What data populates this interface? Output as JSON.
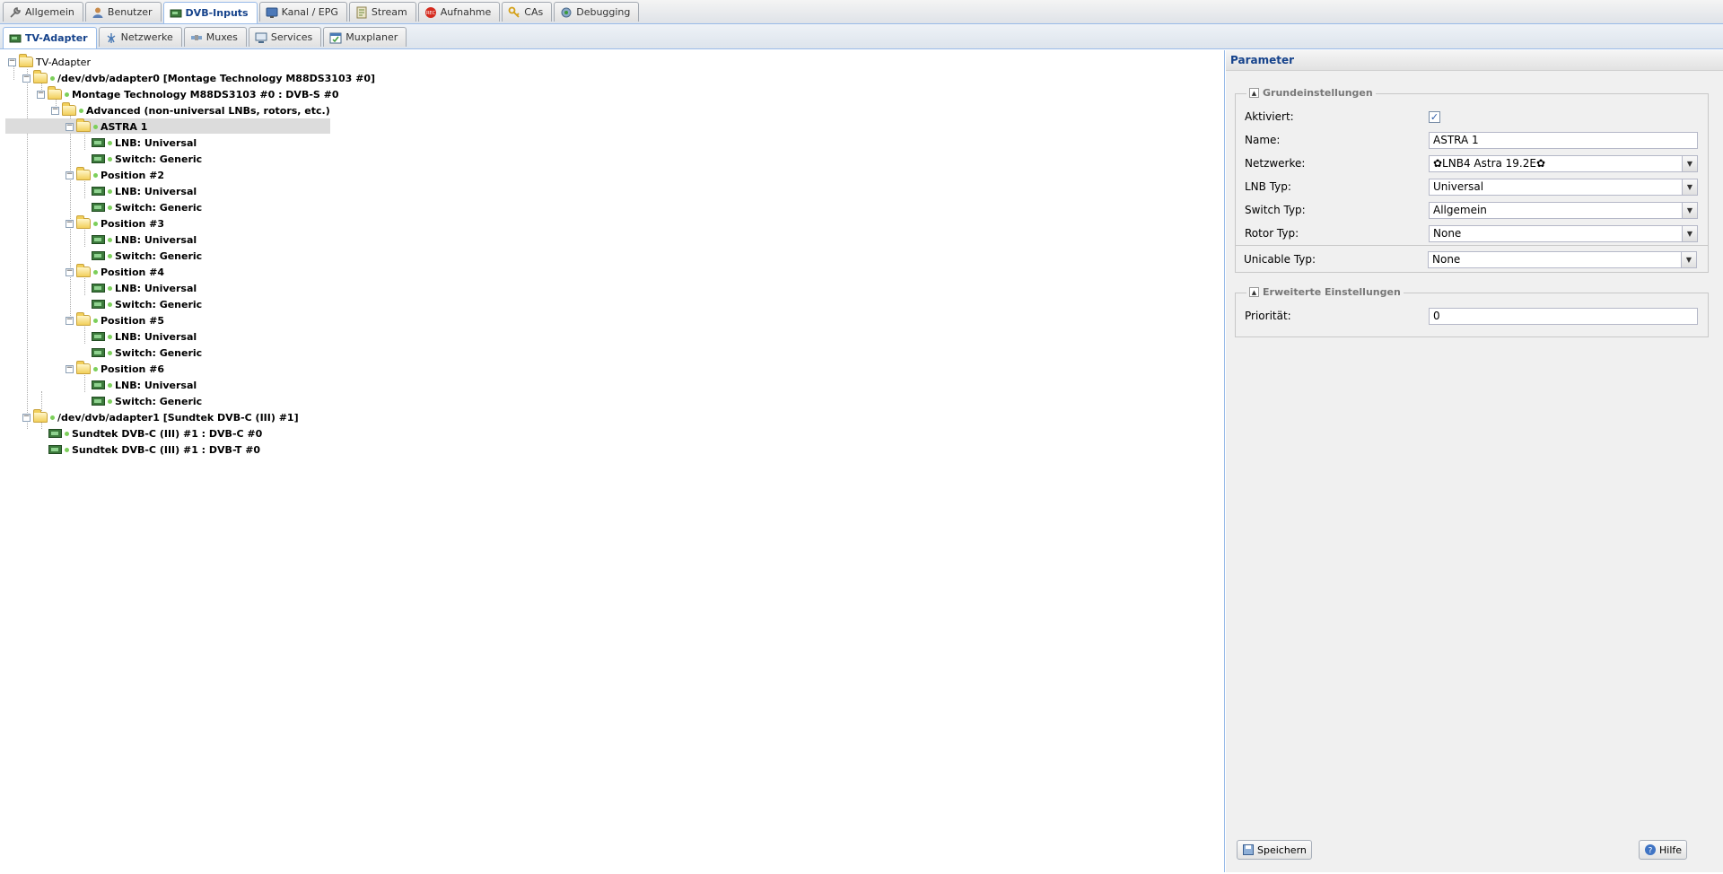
{
  "top_tabs": [
    {
      "label": "Allgemein",
      "icon": "wrench-icon",
      "active": false
    },
    {
      "label": "Benutzer",
      "icon": "user-icon",
      "active": false
    },
    {
      "label": "DVB-Inputs",
      "icon": "tv-card-icon",
      "active": true
    },
    {
      "label": "Kanal / EPG",
      "icon": "tv-icon",
      "active": false
    },
    {
      "label": "Stream",
      "icon": "stream-icon",
      "active": false
    },
    {
      "label": "Aufnahme",
      "icon": "record-icon",
      "active": false
    },
    {
      "label": "CAs",
      "icon": "key-icon",
      "active": false
    },
    {
      "label": "Debugging",
      "icon": "bug-icon",
      "active": false
    }
  ],
  "sub_tabs": [
    {
      "label": "TV-Adapter",
      "icon": "tv-card-icon",
      "active": true
    },
    {
      "label": "Netzwerke",
      "icon": "antenna-icon",
      "active": false
    },
    {
      "label": "Muxes",
      "icon": "satellite-icon",
      "active": false
    },
    {
      "label": "Services",
      "icon": "monitor-icon",
      "active": false
    },
    {
      "label": "Muxplaner",
      "icon": "calendar-icon",
      "active": false
    }
  ],
  "tree": {
    "root": "TV-Adapter",
    "nodes": [
      {
        "label": "/dev/dvb/adapter0 [Montage Technology M88DS3103 #0]"
      },
      {
        "label": "Montage Technology M88DS3103 #0 : DVB-S #0"
      },
      {
        "label": "Advanced (non-universal LNBs, rotors, etc.)"
      },
      {
        "label": "ASTRA 1"
      },
      {
        "label": "LNB: Universal"
      },
      {
        "label": "Switch: Generic"
      },
      {
        "label": "Position #2"
      },
      {
        "label": "LNB: Universal"
      },
      {
        "label": "Switch: Generic"
      },
      {
        "label": "Position #3"
      },
      {
        "label": "LNB: Universal"
      },
      {
        "label": "Switch: Generic"
      },
      {
        "label": "Position #4"
      },
      {
        "label": "LNB: Universal"
      },
      {
        "label": "Switch: Generic"
      },
      {
        "label": "Position #5"
      },
      {
        "label": "LNB: Universal"
      },
      {
        "label": "Switch: Generic"
      },
      {
        "label": "Position #6"
      },
      {
        "label": "LNB: Universal"
      },
      {
        "label": "Switch: Generic"
      },
      {
        "label": "/dev/dvb/adapter1 [Sundtek DVB-C (III) #1]"
      },
      {
        "label": "Sundtek DVB-C (III) #1 : DVB-C #0"
      },
      {
        "label": "Sundtek DVB-C (III) #1 : DVB-T #0"
      }
    ]
  },
  "params": {
    "title": "Parameter",
    "basic": {
      "legend": "Grundeinstellungen",
      "activated_label": "Aktiviert:",
      "activated_checked": "✓",
      "name_label": "Name:",
      "name_value": "ASTRA 1",
      "networks_label": "Netzwerke:",
      "networks_value": "✿LNB4 Astra 19.2E✿",
      "lnb_label": "LNB Typ:",
      "lnb_value": "Universal",
      "switch_label": "Switch Typ:",
      "switch_value": "Allgemein",
      "rotor_label": "Rotor Typ:",
      "rotor_value": "None",
      "unicable_label": "Unicable Typ:",
      "unicable_value": "None"
    },
    "advanced": {
      "legend": "Erweiterte Einstellungen",
      "priority_label": "Priorität:",
      "priority_value": "0"
    },
    "save_label": "Speichern",
    "help_label": "Hilfe"
  },
  "colors": {
    "accent": "#15428b",
    "tab_border": "#99bbe8",
    "selection": "#dcdcdc",
    "status_dot": "#7ccf5a"
  }
}
